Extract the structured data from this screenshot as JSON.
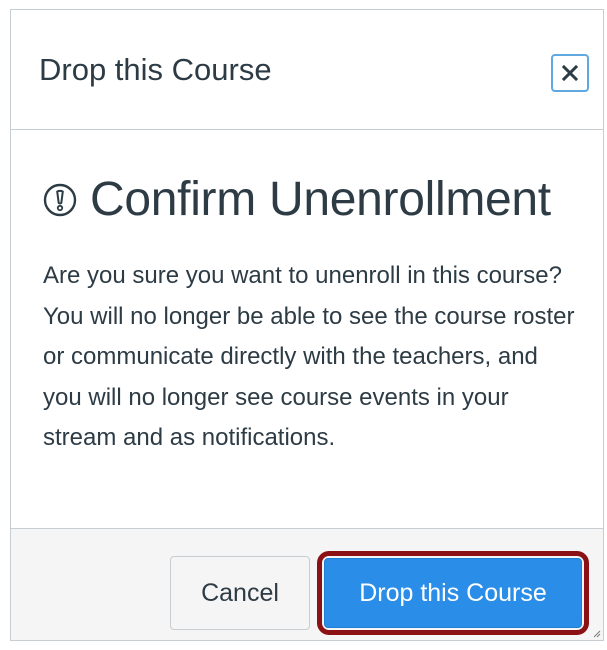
{
  "dialog": {
    "title": "Drop this Course",
    "close_icon": "close-icon"
  },
  "body": {
    "heading_icon": "warning-circle-icon",
    "heading": "Confirm Unenrollment",
    "message": "Are you sure you want to unenroll in this course? You will no longer be able to see the course roster or communicate directly with the teachers, and you will no longer see course events in your stream and as notifications."
  },
  "footer": {
    "cancel_label": "Cancel",
    "drop_label": "Drop this Course"
  },
  "colors": {
    "text": "#2d3b45",
    "primary_button": "#2a8ee8",
    "highlight_outline": "#8b1114",
    "footer_bg": "#f5f5f5",
    "border": "#c7cdd1"
  }
}
